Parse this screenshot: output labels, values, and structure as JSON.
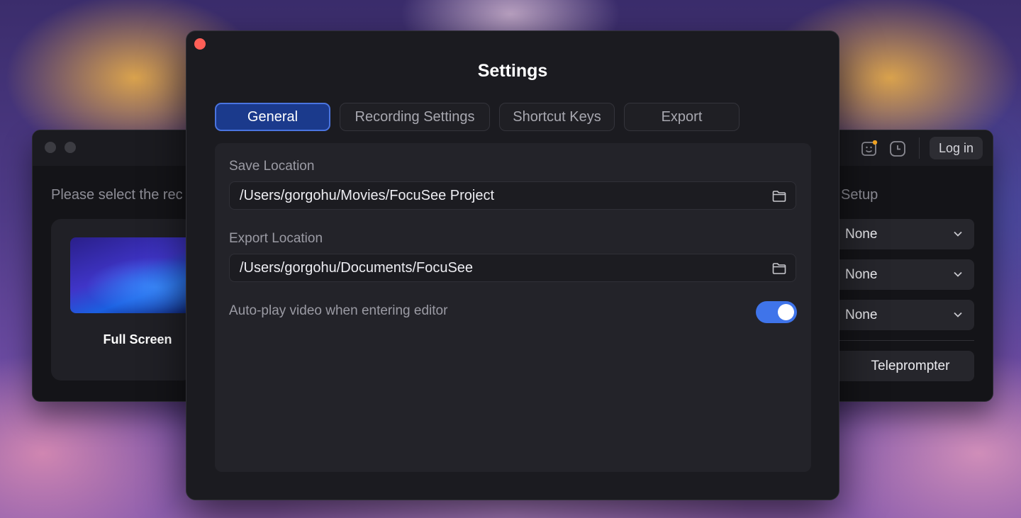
{
  "background_app": {
    "prompt_text": "Please select the rec",
    "fullscreen_card": {
      "label": "Full Screen"
    },
    "header": {
      "login_label": "Log in"
    },
    "setup": {
      "label": "Setup",
      "selects": [
        "None",
        "None",
        "None"
      ],
      "teleprompter_label": "Teleprompter"
    }
  },
  "settings": {
    "title": "Settings",
    "tabs": [
      {
        "label": "General",
        "active": true
      },
      {
        "label": "Recording Settings",
        "active": false
      },
      {
        "label": "Shortcut Keys",
        "active": false
      },
      {
        "label": "Export",
        "active": false
      }
    ],
    "general": {
      "save_location_label": "Save Location",
      "save_location_value": "/Users/gorgohu/Movies/FocuSee Project",
      "export_location_label": "Export Location",
      "export_location_value": "/Users/gorgohu/Documents/FocuSee",
      "autoplay_label": "Auto-play video when entering editor",
      "autoplay_enabled": true
    }
  },
  "colors": {
    "accent": "#3f74ea",
    "active_tab_bg": "#1b3a8c",
    "close_button": "#ff5f57",
    "notification_dot": "#f5a623"
  },
  "icons": [
    "folder-icon",
    "chevron-down-icon",
    "emoji-icon",
    "clock-icon",
    "close-icon"
  ]
}
